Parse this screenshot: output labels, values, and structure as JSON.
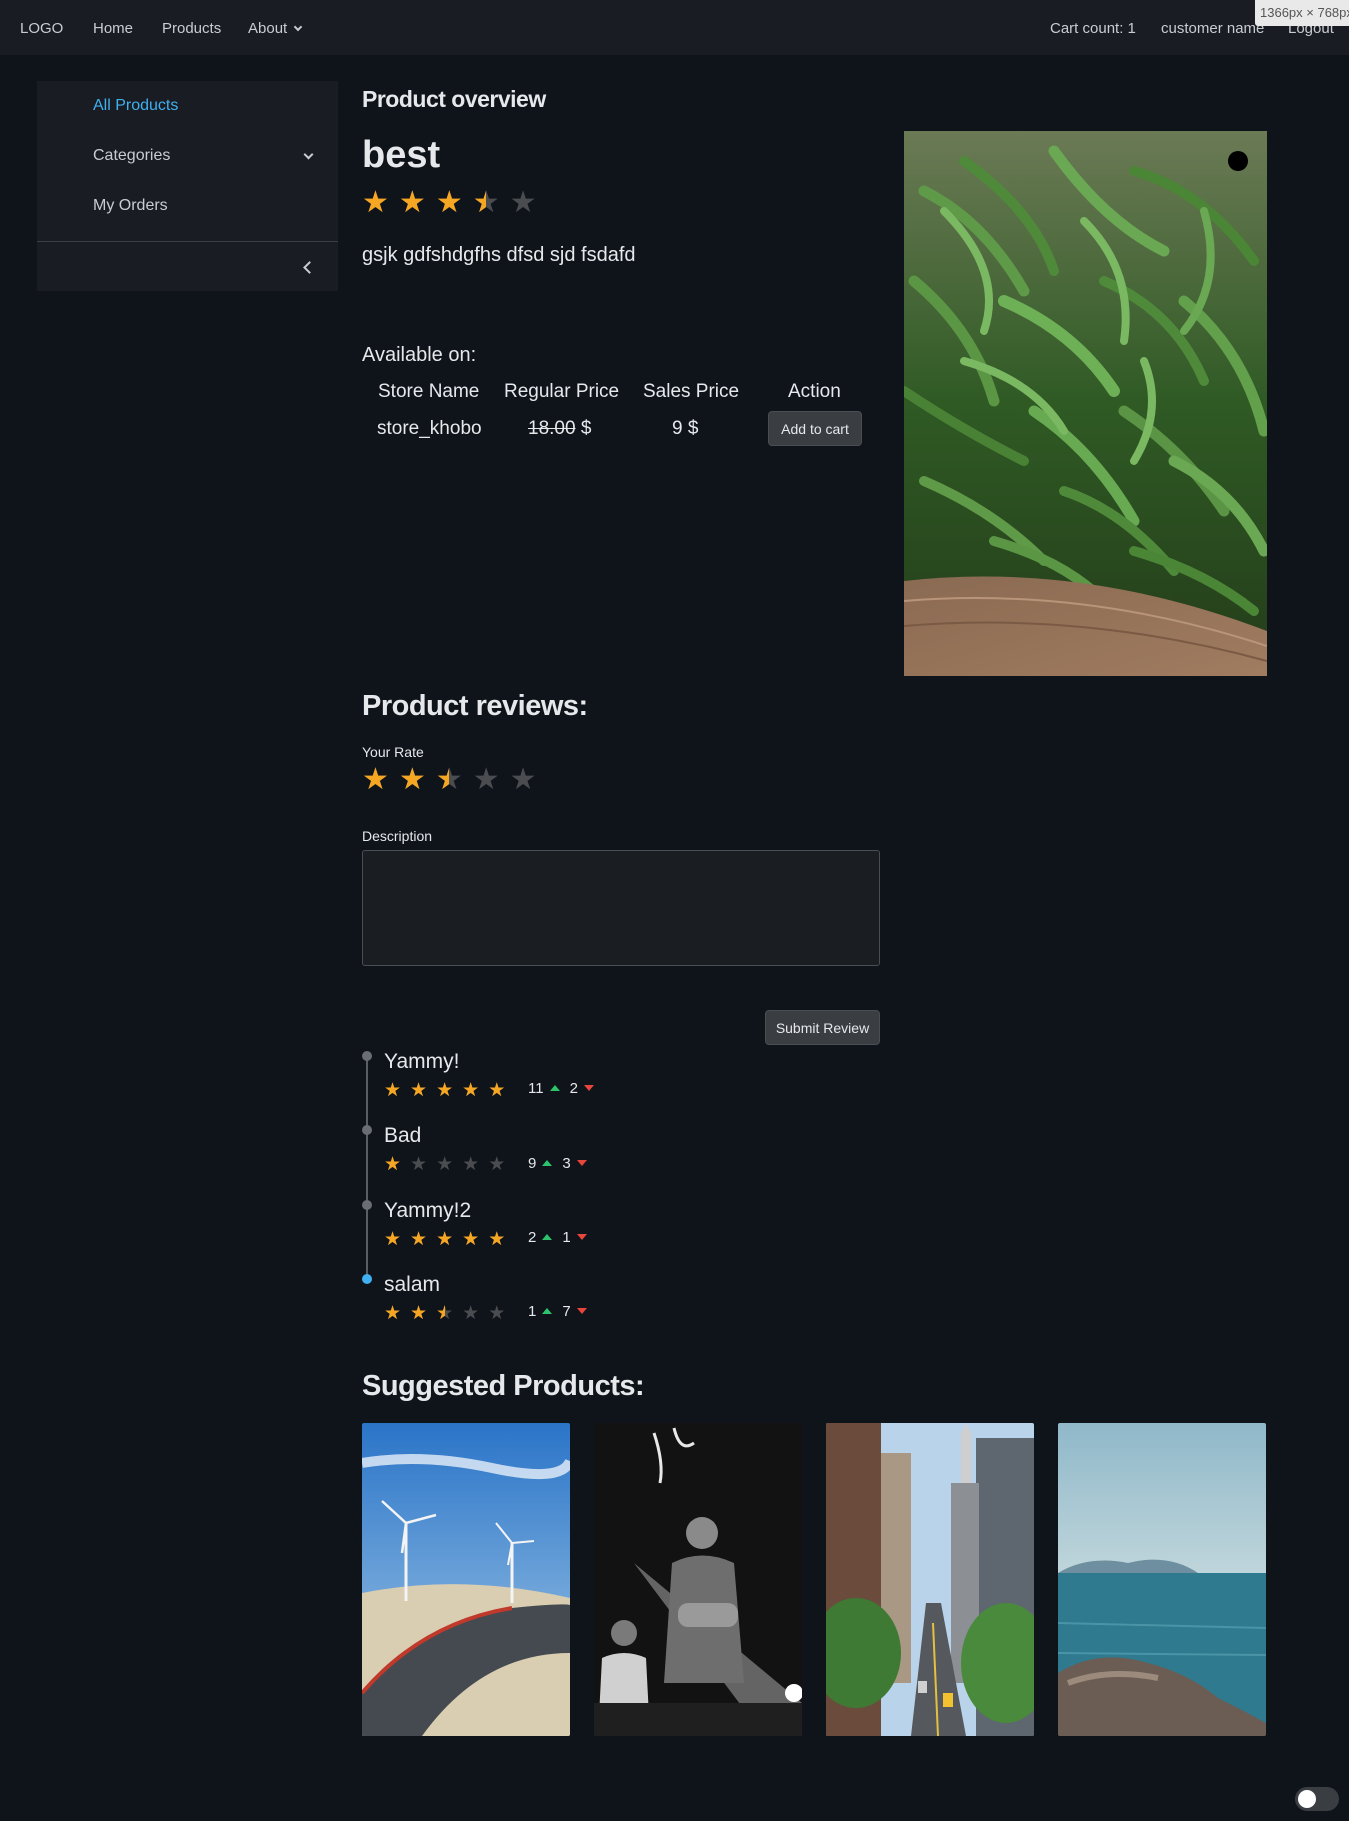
{
  "nav": {
    "logo": "LOGO",
    "home": "Home",
    "products": "Products",
    "about": "About",
    "cart_count": "Cart count: 1",
    "user": "customer name",
    "logout": "Logout",
    "viewport_tag": "1366px × 768px"
  },
  "sidebar": {
    "items": [
      {
        "label": "All Products"
      },
      {
        "label": "Categories"
      },
      {
        "label": "My Orders"
      }
    ]
  },
  "product": {
    "section_title": "Product overview",
    "name": "best",
    "rating": 3.5,
    "rating_max": 5,
    "description": "gsjk gdfshdgfhs dfsd sjd fsdafd",
    "available_label": "Available on:",
    "table": {
      "headers": [
        "Store Name",
        "Regular Price",
        "Sales Price",
        "Action"
      ],
      "rows": [
        {
          "store": "store_khobo",
          "regular": "18.00",
          "currency": "$",
          "sales": "9 $",
          "action": "Add to cart"
        }
      ]
    }
  },
  "reviews": {
    "title": "Product reviews:",
    "your_rate_label": "Your Rate",
    "your_rate": 2.5,
    "description_label": "Description",
    "submit": "Submit Review",
    "items": [
      {
        "title": "Yammy!",
        "rating": 5,
        "up": "11",
        "down": "2"
      },
      {
        "title": "Bad",
        "rating": 1,
        "up": "9",
        "down": "3"
      },
      {
        "title": "Yammy!2",
        "rating": 5,
        "up": "2",
        "down": "1"
      },
      {
        "title": "salam",
        "rating": 2.5,
        "up": "1",
        "down": "7"
      }
    ]
  },
  "suggested": {
    "title": "Suggested Products:"
  },
  "colors": {
    "accent": "#3fb0f0",
    "star": "#f5a623",
    "star_empty": "#4a4c50",
    "up": "#2cc36b",
    "down": "#e8453c",
    "background": "#0f131a",
    "panel": "#191c22"
  }
}
